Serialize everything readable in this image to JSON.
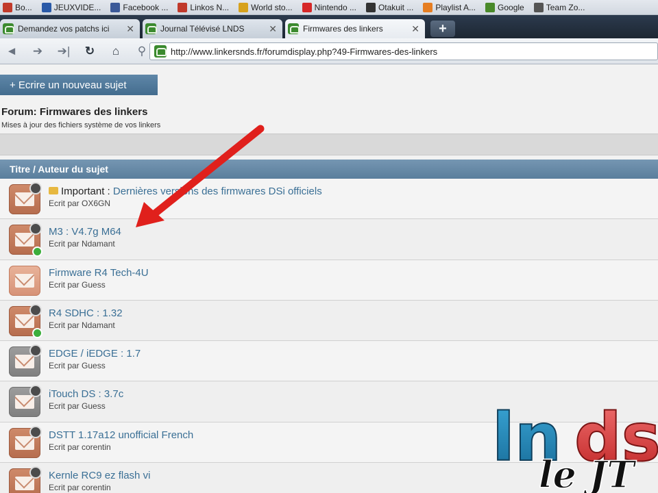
{
  "bookmarks": [
    {
      "label": "Bo...",
      "color": "#c23b2b"
    },
    {
      "label": "JEUXVIDE...",
      "color": "#2a5aa8"
    },
    {
      "label": "Facebook ...",
      "color": "#3b5998"
    },
    {
      "label": "Linkos N...",
      "color": "#c0392b"
    },
    {
      "label": "World sto...",
      "color": "#d7a21d"
    },
    {
      "label": "Nintendo ...",
      "color": "#d62828"
    },
    {
      "label": "Otakuit ...",
      "color": "#333333"
    },
    {
      "label": "Playlist A...",
      "color": "#e67e22"
    },
    {
      "label": "Google",
      "color": "#4a8a2a"
    },
    {
      "label": "Team Zo...",
      "color": "#555555"
    }
  ],
  "tabs": [
    {
      "label": "Demandez vos patchs ici",
      "active": false
    },
    {
      "label": "Journal Télévisé LNDS",
      "active": false
    },
    {
      "label": "Firmwares des linkers",
      "active": true
    }
  ],
  "tab_close": "✕",
  "newtab_label": "+",
  "nav": {
    "back": "◄",
    "forward": "➔",
    "forward_end": "➔|",
    "reload": "↻",
    "home": "⌂",
    "pin": "⚲",
    "url": "http://www.linkersnds.fr/forumdisplay.php?49-Firmwares-des-linkers"
  },
  "page": {
    "new_topic_button": "+ Ecrire un nouveau sujet",
    "forum_title": "Forum: Firmwares des linkers",
    "forum_description": "Mises à jour des fichiers système de vos linkers",
    "table_header": "Titre / Auteur du sujet"
  },
  "threads": [
    {
      "prefix": "Important :",
      "title": "Dernières versions des firmwares DSi officiels",
      "author": "Ecrit par OX6GN",
      "icon": "sticky",
      "new": false
    },
    {
      "prefix": "",
      "title": "M3 : V4.7g M64",
      "author": "Ecrit par Ndamant",
      "icon": "hot",
      "new": true
    },
    {
      "prefix": "",
      "title": "Firmware R4 Tech-4U",
      "author": "Ecrit par Guess",
      "icon": "light",
      "new": false
    },
    {
      "prefix": "",
      "title": "R4 SDHC : 1.32",
      "author": "Ecrit par Ndamant",
      "icon": "hot",
      "new": true
    },
    {
      "prefix": "",
      "title": "EDGE / iEDGE : 1.7",
      "author": "Ecrit par Guess",
      "icon": "grey",
      "new": false
    },
    {
      "prefix": "",
      "title": "iTouch DS : 3.7c",
      "author": "Ecrit par Guess",
      "icon": "grey",
      "new": false
    },
    {
      "prefix": "",
      "title": "DSTT 1.17a12 unofficial French",
      "author": "Ecrit par corentin",
      "icon": "hot",
      "new": false
    },
    {
      "prefix": "",
      "title": "Kernle RC9 ez flash vi",
      "author": "Ecrit par corentin",
      "icon": "hot",
      "new": false
    }
  ],
  "watermark": {
    "top": "lnds",
    "bottom": "le JT"
  },
  "colors": {
    "arrow": "#e0201c",
    "link": "#3a6f95",
    "header": "#5a7e9c",
    "logo_blue": "#1f7fb0",
    "logo_red": "#d83a3a"
  }
}
